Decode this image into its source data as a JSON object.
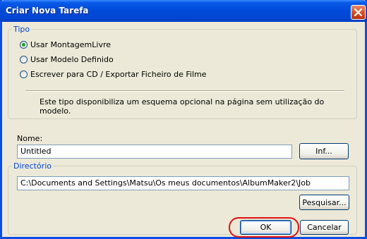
{
  "window": {
    "title": "Criar Nova Tarefa"
  },
  "tipo": {
    "legend": "Tipo",
    "options": [
      {
        "label": "Usar MontagemLivre",
        "checked": true
      },
      {
        "label": "Usar Modelo Definido",
        "checked": false
      },
      {
        "label": "Escrever para CD / Exportar Ficheiro de Filme",
        "checked": false
      }
    ],
    "description": "Este tipo disponibiliza um esquema opcional na página sem utilização do modelo."
  },
  "nome": {
    "label": "Nome:",
    "value": "Untitled",
    "info_button": "Inf..."
  },
  "directorio": {
    "legend": "Directório",
    "path": "C:\\Documents and Settings\\Matsu\\Os meus documentos\\AlbumMaker2\\Job",
    "browse_button": "Pesquisar..."
  },
  "actions": {
    "ok": "OK",
    "cancel": "Cancelar"
  },
  "icons": {
    "close": "close-icon"
  },
  "colors": {
    "titlebar": "#0049d8",
    "legend": "#0046d5",
    "highlight": "#e01010",
    "radio_checked": "#21a121"
  }
}
